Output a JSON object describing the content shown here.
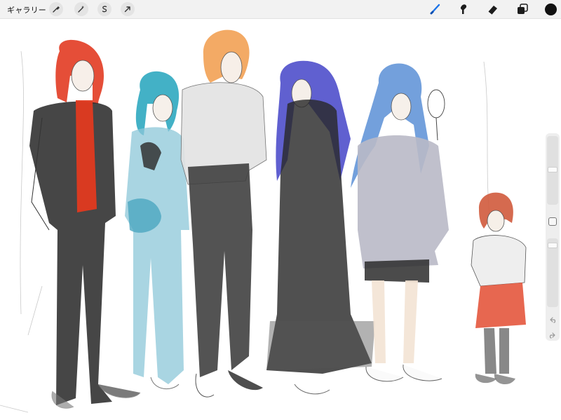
{
  "toolbar": {
    "gallery_label": "ギャラリー",
    "left_tools": [
      "wrench-icon",
      "magic-wand-icon",
      "selection-icon",
      "transform-arrow-icon"
    ],
    "right_tools": [
      "brush-icon",
      "smudge-icon",
      "eraser-icon",
      "layers-icon"
    ],
    "active_tool": "brush-icon",
    "current_color": "#111111",
    "accent_color": "#1a73e8"
  },
  "sidebar": {
    "brush_size": 0.52,
    "opacity": 0.95,
    "controls": [
      "brush-size-slider",
      "modify-button",
      "opacity-slider",
      "undo-button",
      "redo-button"
    ]
  },
  "canvas": {
    "content": "character-sketch",
    "figure_count": 6
  }
}
